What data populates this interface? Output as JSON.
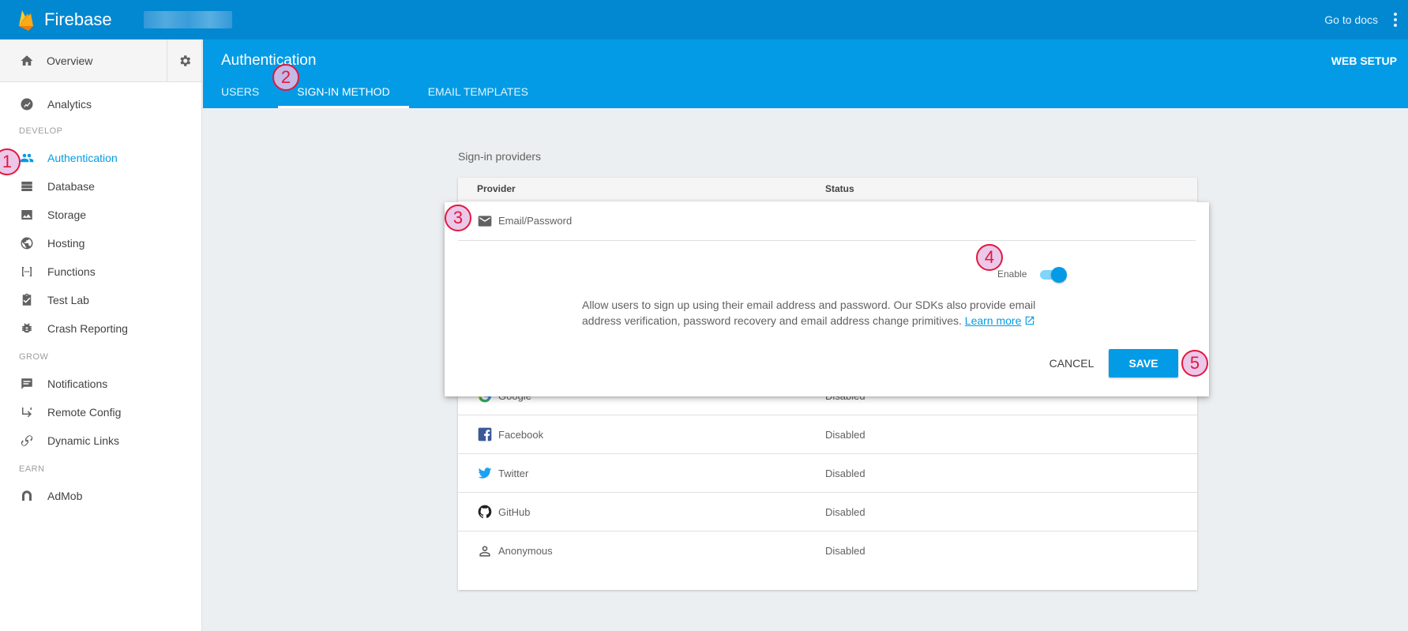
{
  "topbar": {
    "app_name": "Firebase",
    "goto_docs": "Go to docs"
  },
  "sidebar": {
    "overview": "Overview",
    "items": [
      {
        "label": "Analytics",
        "icon": "analytics-icon"
      },
      {
        "label": "Authentication",
        "icon": "people-icon",
        "active": true
      },
      {
        "label": "Database",
        "icon": "database-icon"
      },
      {
        "label": "Storage",
        "icon": "image-icon"
      },
      {
        "label": "Hosting",
        "icon": "globe-icon"
      },
      {
        "label": "Functions",
        "icon": "functions-icon"
      },
      {
        "label": "Test Lab",
        "icon": "clipboard-check-icon"
      },
      {
        "label": "Crash Reporting",
        "icon": "bug-icon"
      },
      {
        "label": "Notifications",
        "icon": "message-icon"
      },
      {
        "label": "Remote Config",
        "icon": "remote-config-icon"
      },
      {
        "label": "Dynamic Links",
        "icon": "link-icon"
      },
      {
        "label": "AdMob",
        "icon": "admob-icon"
      }
    ],
    "sections": {
      "develop": "DEVELOP",
      "grow": "GROW",
      "earn": "EARN"
    }
  },
  "header": {
    "title": "Authentication",
    "web_setup": "WEB SETUP",
    "tabs": [
      {
        "label": "USERS"
      },
      {
        "label": "SIGN-IN METHOD",
        "active": true
      },
      {
        "label": "EMAIL TEMPLATES"
      }
    ]
  },
  "main": {
    "section_title": "Sign-in providers",
    "columns": {
      "provider": "Provider",
      "status": "Status"
    },
    "email": {
      "name": "Email/Password",
      "enable_label": "Enable",
      "enabled": true,
      "description": "Allow users to sign up using their email address and password. Our SDKs also provide email address verification, password recovery and email address change primitives.",
      "learn_more": "Learn more",
      "cancel": "CANCEL",
      "save": "SAVE"
    },
    "providers": [
      {
        "name": "Google",
        "status": "Disabled",
        "icon": "google-icon"
      },
      {
        "name": "Facebook",
        "status": "Disabled",
        "icon": "facebook-icon"
      },
      {
        "name": "Twitter",
        "status": "Disabled",
        "icon": "twitter-icon"
      },
      {
        "name": "GitHub",
        "status": "Disabled",
        "icon": "github-icon"
      },
      {
        "name": "Anonymous",
        "status": "Disabled",
        "icon": "person-icon"
      }
    ]
  },
  "markers": [
    "1",
    "2",
    "3",
    "4",
    "5"
  ],
  "colors": {
    "topbar": "#0288d1",
    "header": "#039be5",
    "accent": "#039be5",
    "marker": "#e3173e"
  }
}
